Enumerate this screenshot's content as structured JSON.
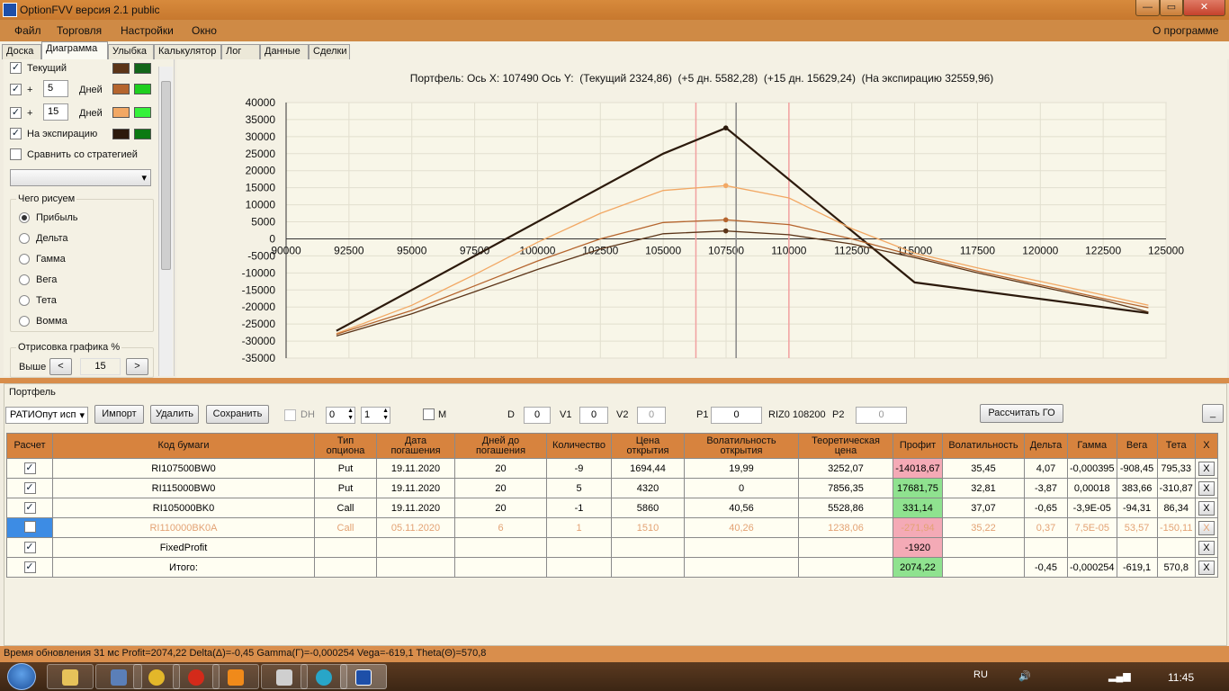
{
  "window": {
    "title": "OptionFVV версия 2.1 public",
    "min": "—",
    "max": "▭",
    "close": "✕"
  },
  "menu": {
    "items": [
      "Файл",
      "Торговля",
      "Настройки",
      "Окно"
    ],
    "about": "О программе"
  },
  "tabs": [
    "Доска",
    "Диаграмма",
    "Улыбка",
    "Калькулятор",
    "Лог",
    "Данные",
    "Сделки"
  ],
  "left": {
    "current_label": "Текущий",
    "plus": "+",
    "days_label": "Дней",
    "days1": "5",
    "days2": "15",
    "expiry_label": "На экспирацию",
    "compare_label": "Сравнить со стратегией",
    "what_group": "Чего рисуем",
    "radios": [
      "Прибыль",
      "Дельта",
      "Гамма",
      "Вега",
      "Тета",
      "Вомма"
    ],
    "render_group": "Отрисовка графика %",
    "above_label": "Выше",
    "above_value": "15",
    "prev": "<",
    "next": ">",
    "swatches": [
      [
        "#5b3418",
        "#12661a"
      ],
      [
        "#b5652e",
        "#1fcf1f"
      ],
      [
        "#f2a864",
        "#36f23a"
      ],
      [
        "#2c1a0c",
        "#0c7a12"
      ]
    ]
  },
  "chart": {
    "title": "Портфель: Ось X: 107490 Ось Y:  (Текущий 2324,86)  (+5 дн. 5582,28)  (+15 дн. 15629,24)  (На экспирацию 32559,96)"
  },
  "chart_data": {
    "type": "line",
    "title": "Портфель: Ось X: 107490 Ось Y:  (Текущий 2324,86)  (+5 дн. 5582,28)  (+15 дн. 15629,24)  (На экспирацию 32559,96)",
    "xlim": [
      90000,
      125000
    ],
    "ylim": [
      -35000,
      40000
    ],
    "x_ticks": [
      "90000",
      "92500",
      "95000",
      "97500",
      "100000",
      "102500",
      "105000",
      "107500",
      "110000",
      "112500",
      "115000",
      "117500",
      "120000",
      "122500",
      "125000"
    ],
    "y_ticks": [
      "40000",
      "35000",
      "30000",
      "25000",
      "20000",
      "15000",
      "10000",
      "5000",
      "0",
      "-5000",
      "-10000",
      "-15000",
      "-20000",
      "-25000",
      "-30000",
      "-35000"
    ],
    "grid": true,
    "vlines": [
      {
        "x": 106300,
        "color": "#f2a0a0"
      },
      {
        "x": 107900,
        "color": "#888888"
      },
      {
        "x": 110000,
        "color": "#f2a0a0"
      }
    ],
    "series": [
      {
        "color": "#2c1a0c",
        "points": [
          [
            92000,
            -27000
          ],
          [
            105000,
            25000
          ],
          [
            107500,
            32560
          ],
          [
            115000,
            -12800
          ],
          [
            124300,
            -21800
          ]
        ]
      },
      {
        "color": "#f2a864",
        "points": [
          [
            92000,
            -27800
          ],
          [
            95000,
            -19500
          ],
          [
            97500,
            -10500
          ],
          [
            100000,
            -1000
          ],
          [
            102500,
            7500
          ],
          [
            105000,
            14200
          ],
          [
            107490,
            15629
          ],
          [
            110000,
            12000
          ],
          [
            112500,
            3000
          ],
          [
            115000,
            -4200
          ],
          [
            117500,
            -8500
          ],
          [
            120000,
            -12500
          ],
          [
            122500,
            -16500
          ],
          [
            124300,
            -19500
          ]
        ]
      },
      {
        "color": "#b5652e",
        "points": [
          [
            92000,
            -28000
          ],
          [
            95000,
            -21000
          ],
          [
            97500,
            -13800
          ],
          [
            100000,
            -6500
          ],
          [
            102500,
            0
          ],
          [
            105000,
            4800
          ],
          [
            107490,
            5582
          ],
          [
            110000,
            4200
          ],
          [
            112500,
            0
          ],
          [
            115000,
            -5000
          ],
          [
            117500,
            -9500
          ],
          [
            120000,
            -13500
          ],
          [
            122500,
            -17500
          ],
          [
            124300,
            -20200
          ]
        ]
      },
      {
        "color": "#5b3418",
        "points": [
          [
            92000,
            -28500
          ],
          [
            95000,
            -22000
          ],
          [
            97500,
            -15500
          ],
          [
            100000,
            -9000
          ],
          [
            102500,
            -3000
          ],
          [
            105000,
            1500
          ],
          [
            107490,
            2325
          ],
          [
            110000,
            1200
          ],
          [
            112500,
            -1500
          ],
          [
            115000,
            -5500
          ],
          [
            117500,
            -10000
          ],
          [
            120000,
            -14000
          ],
          [
            122500,
            -18000
          ],
          [
            124300,
            -21500
          ]
        ]
      }
    ],
    "markers": [
      {
        "x": 107490,
        "y": 32560,
        "color": "#2c1a0c"
      },
      {
        "x": 107490,
        "y": 15629,
        "color": "#f2a864"
      },
      {
        "x": 107490,
        "y": 5582,
        "color": "#b5652e"
      },
      {
        "x": 107490,
        "y": 2325,
        "color": "#5b3418"
      }
    ]
  },
  "portfolio": {
    "label": "Портфель",
    "select": "РАТИОпут исп",
    "import": "Импорт",
    "delete": "Удалить",
    "save": "Сохранить",
    "dh": "DH",
    "spin1": "0",
    "spin2": "1",
    "m": "M",
    "d_label": "D",
    "d_val": "0",
    "v1_label": "V1",
    "v1_val": "0",
    "v2_label": "V2",
    "v2_val": "0",
    "p1_label": "P1",
    "p1_val": "0",
    "riz": "RIZ0 108200",
    "p2_label": "P2",
    "p2_val": "0",
    "calc_go": "Рассчитать ГО",
    "small_btn": "_"
  },
  "table": {
    "headers": [
      "Расчет",
      "Код бумаги",
      "Тип опциона",
      "Дата погашения",
      "Дней до погашения",
      "Количество",
      "Цена открытия",
      "Волатильность открытия",
      "Теоретическая цена",
      "Профит",
      "Волатильность",
      "Дельта",
      "Гамма",
      "Вега",
      "Тета",
      "X"
    ],
    "rows": [
      {
        "checked": true,
        "code": "RI107500BW0",
        "type": "Put",
        "date": "19.11.2020",
        "days": "20",
        "qty": "-9",
        "price": "1694,44",
        "vol_open": "19,99",
        "theo": "3252,07",
        "profit": "-14018,67",
        "pstyle": "neg",
        "vol": "35,45",
        "delta": "4,07",
        "gamma": "-0,000395",
        "vega": "-908,45",
        "theta": "795,33",
        "x": "X",
        "dis": false
      },
      {
        "checked": true,
        "code": "RI115000BW0",
        "type": "Put",
        "date": "19.11.2020",
        "days": "20",
        "qty": "5",
        "price": "4320",
        "vol_open": "0",
        "theo": "7856,35",
        "profit": "17681,75",
        "pstyle": "pos",
        "vol": "32,81",
        "delta": "-3,87",
        "gamma": "0,00018",
        "vega": "383,66",
        "theta": "-310,87",
        "x": "X",
        "dis": false
      },
      {
        "checked": true,
        "code": "RI105000BK0",
        "type": "Call",
        "date": "19.11.2020",
        "days": "20",
        "qty": "-1",
        "price": "5860",
        "vol_open": "40,56",
        "theo": "5528,86",
        "profit": "331,14",
        "pstyle": "pos",
        "vol": "37,07",
        "delta": "-0,65",
        "gamma": "-3,9E-05",
        "vega": "-94,31",
        "theta": "86,34",
        "x": "X",
        "dis": false
      },
      {
        "checked": false,
        "code": "RI110000BK0A",
        "type": "Call",
        "date": "05.11.2020",
        "days": "6",
        "qty": "1",
        "price": "1510",
        "vol_open": "40,26",
        "theo": "1238,06",
        "profit": "-271,94",
        "pstyle": "neg",
        "vol": "35,22",
        "delta": "0,37",
        "gamma": "7,5E-05",
        "vega": "53,57",
        "theta": "-150,11",
        "x": "X",
        "dis": true
      },
      {
        "checked": true,
        "code": "FixedProfit",
        "type": "",
        "date": "",
        "days": "",
        "qty": "",
        "price": "",
        "vol_open": "",
        "theo": "",
        "profit": "-1920",
        "pstyle": "neg",
        "vol": "",
        "delta": "",
        "gamma": "",
        "vega": "",
        "theta": "",
        "x": "X",
        "dis": false
      },
      {
        "checked": true,
        "code": "Итого:",
        "type": "",
        "date": "",
        "days": "",
        "qty": "",
        "price": "",
        "vol_open": "",
        "theo": "",
        "profit": "2074,22",
        "pstyle": "pos",
        "vol": "",
        "delta": "-0,45",
        "gamma": "-0,000254",
        "vega": "-619,1",
        "theta": "570,8",
        "x": "X",
        "dis": false
      }
    ]
  },
  "status": "Время обновления 31 мс  Profit=2074,22 Delta(Δ)=-0,45 Gamma(Γ)=-0,000254 Vega=-619,1 Theta(Θ)=570,8",
  "taskbar": {
    "lang": "RU",
    "time": "11:45"
  }
}
